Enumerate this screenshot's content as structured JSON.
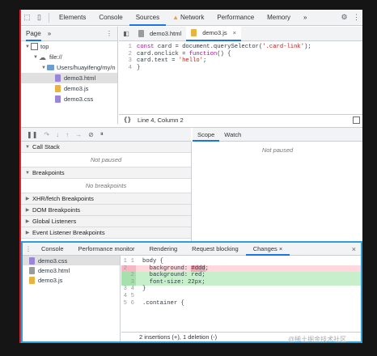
{
  "toolbar": {
    "tabs": [
      "Elements",
      "Console",
      "Sources",
      "Network",
      "Performance",
      "Memory"
    ],
    "selected": "Sources",
    "more": "»"
  },
  "navigator": {
    "tab": "Page",
    "more": "»",
    "tree": [
      {
        "label": "top",
        "depth": 0,
        "kind": "frame"
      },
      {
        "label": "file://",
        "depth": 1,
        "kind": "origin"
      },
      {
        "label": "Users/huayifeng/my/n",
        "depth": 2,
        "kind": "folder"
      },
      {
        "label": "demo3.html",
        "depth": 3,
        "kind": "html",
        "selected": true
      },
      {
        "label": "demo3.js",
        "depth": 3,
        "kind": "js"
      },
      {
        "label": "demo3.css",
        "depth": 3,
        "kind": "css"
      }
    ]
  },
  "editor": {
    "tabs": [
      {
        "label": "demo3.html",
        "selected": false
      },
      {
        "label": "demo3.js",
        "selected": true
      }
    ],
    "code": [
      "const card = document.querySelector('.card-link');",
      "card.onclick = function() {",
      "    card.text = 'hello';",
      "}"
    ],
    "status_position": "Line 4, Column 2",
    "status_brackets": "{}"
  },
  "debugger": {
    "sections": [
      {
        "label": "Call Stack",
        "expanded": true,
        "message": "Not paused"
      },
      {
        "label": "Breakpoints",
        "expanded": true,
        "message": "No breakpoints"
      },
      {
        "label": "XHR/fetch Breakpoints",
        "expanded": false
      },
      {
        "label": "DOM Breakpoints",
        "expanded": false
      },
      {
        "label": "Global Listeners",
        "expanded": false
      },
      {
        "label": "Event Listener Breakpoints",
        "expanded": false
      }
    ],
    "right_tabs": [
      {
        "label": "Scope",
        "selected": true
      },
      {
        "label": "Watch",
        "selected": false
      }
    ],
    "right_message": "Not paused"
  },
  "drawer": {
    "tabs": [
      {
        "label": "Console",
        "selected": false
      },
      {
        "label": "Performance monitor",
        "selected": false
      },
      {
        "label": "Rendering",
        "selected": false
      },
      {
        "label": "Request blocking",
        "selected": false
      },
      {
        "label": "Changes",
        "selected": true
      }
    ],
    "files": [
      {
        "label": "demo3.css",
        "kind": "css",
        "selected": true
      },
      {
        "label": "demo3.html",
        "kind": "html"
      },
      {
        "label": "demo3.js",
        "kind": "js"
      }
    ],
    "diff": [
      {
        "n1": "1",
        "n2": "1",
        "text": "body {",
        "type": "ctx"
      },
      {
        "n1": "2",
        "n2": "",
        "text": "  background: #ddd;",
        "type": "del"
      },
      {
        "n1": "",
        "n2": "2",
        "text": "  background: red;",
        "type": "add"
      },
      {
        "n1": "",
        "n2": "3",
        "text": "  font-size: 22px;",
        "type": "add"
      },
      {
        "n1": "3",
        "n2": "4",
        "text": "}",
        "type": "ctx"
      },
      {
        "n1": "4",
        "n2": "5",
        "text": "",
        "type": "ctx"
      },
      {
        "n1": "5",
        "n2": "6",
        "text": ".container {",
        "type": "ctx"
      }
    ],
    "summary": "2 insertions (+), 1 deletion (-)"
  },
  "watermark": "@稀土掘金技术社区",
  "colors": {
    "accent": "#1a73e8",
    "drawer_border": "#2f9ed9",
    "left_border": "#e3232a"
  }
}
